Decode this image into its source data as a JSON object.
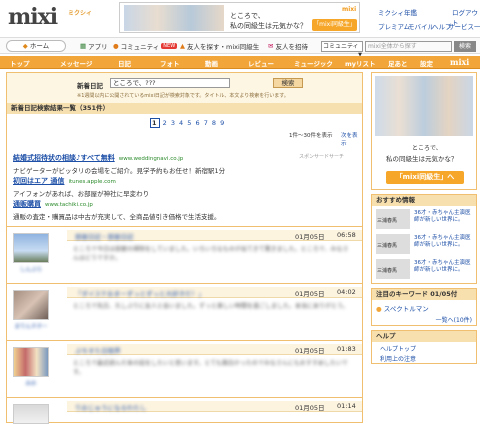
{
  "header": {
    "logo": "mixi",
    "logo_sub": "ミクシィ",
    "banner_line1": "ところで、",
    "banner_line2": "私の同級生は元気かな？",
    "banner_btn": "「mixi同級生」へ",
    "banner_brand": "mixi",
    "links": {
      "mixi_school": "ミクシィ年鑑",
      "logout": "ログアウト",
      "premium": "プレミアム",
      "mobile": "モバイル",
      "help": "ヘルプ",
      "service": "サービス一覧"
    }
  },
  "nav": {
    "home": "ホーム",
    "app": "アプリ",
    "community": "コミュニティ",
    "new_badge": "NEW",
    "find_friends": "友人を探す・mixi同級生",
    "invite": "友人を招待",
    "search_select": "コミュニティ",
    "search_placeholder": "mixi全体から探す",
    "search_btn": "検索"
  },
  "orange_nav": [
    "トップ",
    "メッセージ",
    "日記",
    "フォト",
    "動画",
    "レビュー",
    "ミュージック",
    "myリスト",
    "足あと",
    "設定"
  ],
  "orange_brand": "mixi",
  "search": {
    "label": "新着日記",
    "value": "ところで、???",
    "button": "検索",
    "hint": "※1週間以内に公開されているmixi日記が検索対象です。タイトル、本文より検索を行います。"
  },
  "results": {
    "title": "新着日記検索結果一覧（351件）",
    "pages": [
      "1",
      "2",
      "3",
      "4",
      "5",
      "6",
      "7",
      "8",
      "9"
    ],
    "count": "1件〜30件を表示",
    "next": "次を表示"
  },
  "sponsor": "スポンサードサーチ",
  "ads": [
    {
      "title": "結婚式招待状の相談♪すべて無料",
      "url": "www.weddingnavi.co.jp",
      "desc": "ナビゲーターがビッタリの会場をご紹介。見学予約もお任せ！新宿駅1分"
    },
    {
      "title": "初回はエア 通信",
      "url": "itunes.apple.com",
      "desc": "アイフォンがあれば、お部屋が神社に早変わり"
    },
    {
      "title": "通販購買",
      "url": "www.tachiki.co.jp",
      "desc": "通販の査定・購買品は中古が充実して、全商品値引き価格で生活支援。"
    }
  ],
  "entries": [
    {
      "cap": "しんぶら",
      "title": "部屋日記・部屋日記",
      "date": "01月05日",
      "time": "06:58",
      "body": "ところで今日は部屋の掃除をしていました。いろいろなものが出てきて驚きました。ところで、みなさんはどうですか。"
    },
    {
      "cap": "まりんネター",
      "title": "「ダイスケおまーずっとずっと大好きだ！」",
      "date": "01月05日",
      "time": "04:02",
      "body": "ところで先日、久しぶりに友人と会いました。ずっと楽しい時間を過ごしました。本当にありがとう。"
    },
    {
      "cap": "みお",
      "title": "ぷちすた日限界",
      "date": "01月05日",
      "time": "01:83",
      "body": "ところで最近読んだ本の話をしたいと思います。とても面白かったのでみなさんにもおすすめしたいです。"
    },
    {
      "cap": "",
      "title": "りおじゅうになるわたし",
      "date": "01月05日",
      "time": "01:14",
      "body": ""
    }
  ],
  "right": {
    "promo_line1": "ところで、",
    "promo_line2": "私の同級生は元気かな？",
    "promo_btn": "「mixi同級生」へ",
    "recommend": "おすすめ情報",
    "recs": [
      {
        "name": "三浦春馬",
        "text": "36才・赤ちゃん主演医師が新しい世界に。"
      },
      {
        "name": "三浦春馬",
        "text": "36才・赤ちゃん主演医師が新しい世界に。"
      },
      {
        "name": "三浦春馬",
        "text": "36才・赤ちゃん主演医師が新しい世界に。"
      }
    ],
    "keywords_title": "注目のキーワード 01/05付",
    "keyword": "スペクトルマン",
    "keywords_more": "一覧へ(10件)",
    "help_title": "ヘルプ",
    "help_links": [
      "ヘルプトップ",
      "利用上の注意"
    ]
  }
}
